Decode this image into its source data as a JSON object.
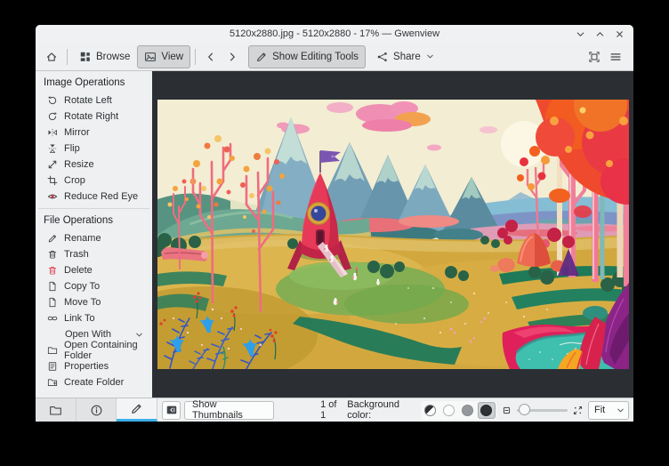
{
  "window": {
    "title": "5120x2880.jpg - 5120x2880 - 17% — Gwenview"
  },
  "toolbar": {
    "browse": "Browse",
    "view": "View",
    "show_editing_tools": "Show Editing Tools",
    "share": "Share"
  },
  "sidebar": {
    "sections": [
      {
        "title": "Image Operations",
        "items": [
          "Rotate Left",
          "Rotate Right",
          "Mirror",
          "Flip",
          "Resize",
          "Crop",
          "Reduce Red Eye"
        ]
      },
      {
        "title": "File Operations",
        "items": [
          "Rename",
          "Trash",
          "Delete",
          "Copy To",
          "Move To",
          "Link To",
          "Open With",
          "Open Containing Folder",
          "Properties",
          "Create Folder"
        ]
      }
    ]
  },
  "statusbar": {
    "show_thumbnails": "Show Thumbnails",
    "counter": "1 of 1",
    "background_color_label": "Background color:",
    "zoom_mode": "Fit"
  },
  "image": {
    "filename": "5120x2880.jpg",
    "description": "Colorful illustration of a pink rocket with a purple flag and landing ramp on a golden meadow, blue snow-capped mountains, autumn orange trees, tiny astronauts and a teal pond"
  },
  "icons": {
    "window_controls": [
      "minimize",
      "maximize",
      "close"
    ],
    "toolbar": [
      "home",
      "browse-grid",
      "view-image",
      "back",
      "forward",
      "pencil",
      "share",
      "fullscreen",
      "menu"
    ],
    "sidebar_tabs": [
      "folder",
      "info",
      "pencil"
    ],
    "statusbar": [
      "collapse-sidebar",
      "bg-auto",
      "bg-light",
      "bg-neutral",
      "bg-dark",
      "zoom-out",
      "zoom-in",
      "dropdown-caret"
    ]
  },
  "colors": {
    "accent": "#3daee9",
    "danger": "#da4453",
    "viewer_background": "#2b2f33",
    "chrome": "#eff0f1"
  }
}
